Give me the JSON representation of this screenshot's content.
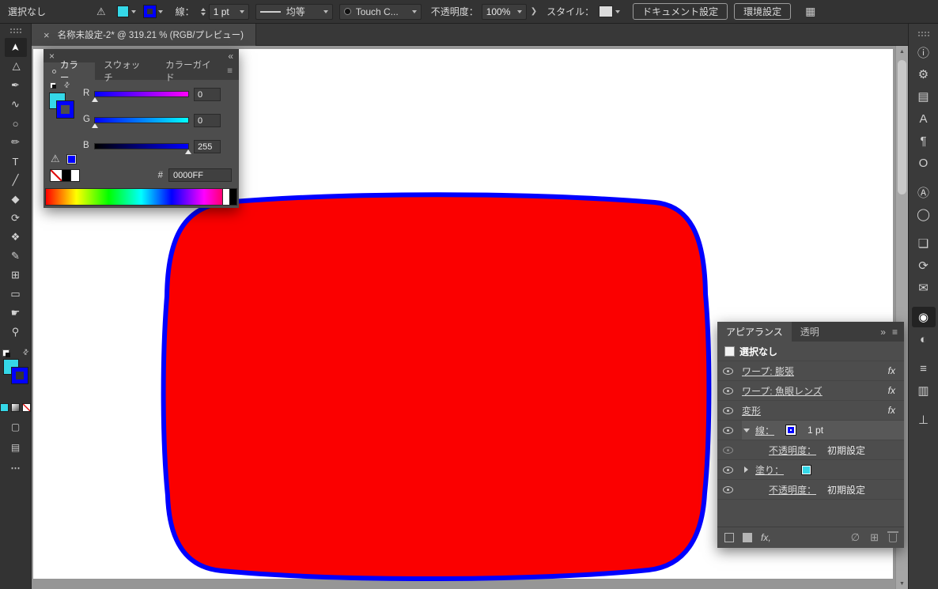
{
  "colors": {
    "fill_cyan": "#35d8e8",
    "stroke_blue": "#0000ff",
    "shape_fill_red": "#fb0000",
    "artboard_white": "#ffffff",
    "pasteboard_gray": "#969696"
  },
  "control_bar": {
    "selection_status": "選択なし",
    "warning_glyph": "⚠",
    "stroke_label": "線：",
    "stroke_weight": "1 pt",
    "stroke_profile": "均等",
    "brush_name": "Touch C...",
    "opacity_label": "不透明度：",
    "opacity_value": "100%",
    "more_chevron": "❯",
    "style_label": "スタイル：",
    "document_setup_button": "ドキュメント設定",
    "preferences_button": "環境設定",
    "workspace_glyph": "▦"
  },
  "document_tab": {
    "close_label": "×",
    "title": "名称未設定-2* @ 319.21 % (RGB/プレビュー)"
  },
  "toolbar": {
    "tools": [
      {
        "name": "selection-tool",
        "glyph": "➤"
      },
      {
        "name": "direct-selection-tool",
        "glyph": "▷"
      },
      {
        "name": "pen-tool",
        "glyph": "✒"
      },
      {
        "name": "curvature-tool",
        "glyph": "∿"
      },
      {
        "name": "ellipse-tool",
        "glyph": "○"
      },
      {
        "name": "paintbrush-tool",
        "glyph": "✏"
      },
      {
        "name": "type-tool",
        "glyph": "T"
      },
      {
        "name": "line-segment-tool",
        "glyph": "╱"
      },
      {
        "name": "shaper-tool",
        "glyph": "◆"
      },
      {
        "name": "rotate-tool",
        "glyph": "⟳"
      },
      {
        "name": "shape-builder-tool",
        "glyph": "❖"
      },
      {
        "name": "pencil-tool",
        "glyph": "✎"
      },
      {
        "name": "mesh-tool",
        "glyph": "⊞"
      },
      {
        "name": "artboard-tool",
        "glyph": "▭"
      },
      {
        "name": "hand-tool",
        "glyph": "☛"
      },
      {
        "name": "zoom-tool",
        "glyph": "⚲"
      }
    ]
  },
  "color_panel": {
    "close_label": "×",
    "collapse_label": "«",
    "menu_label": "≡",
    "tabs": [
      {
        "label": "カラー",
        "active": true
      },
      {
        "label": "スウォッチ"
      },
      {
        "label": "カラーガイド"
      }
    ],
    "warning_glyph": "⚠",
    "sliders": [
      {
        "label": "R",
        "value": "0",
        "track": [
          "#0000ff",
          "#ff00ff"
        ]
      },
      {
        "label": "G",
        "value": "0",
        "track": [
          "#0000ff",
          "#00ffff"
        ]
      },
      {
        "label": "B",
        "value": "255",
        "track": [
          "#000000",
          "#0000ff"
        ]
      }
    ],
    "hex_label": "#",
    "hex_value": "0000FF"
  },
  "appearance_panel": {
    "tabs": [
      {
        "label": "アピアランス",
        "active": true
      },
      {
        "label": "透明"
      }
    ],
    "collapse_label": "»",
    "menu_label": "≡",
    "rows": [
      {
        "label": "選択なし"
      },
      {
        "label": "ワープ: 膨張",
        "fx": "fx"
      },
      {
        "label": "ワープ: 魚眼レンズ",
        "fx": "fx"
      },
      {
        "label": "変形",
        "fx": "fx"
      },
      {
        "label": "線：",
        "value": "1 pt",
        "swatch": "#0000ff"
      },
      {
        "label": "不透明度：",
        "value": "初期設定"
      },
      {
        "label": "塗り：",
        "swatch": "#35d8e8"
      },
      {
        "label": "不透明度：",
        "value": "初期設定"
      }
    ],
    "footer": {
      "fx_label": "fx,",
      "clear_glyph": "∅",
      "duplicate_glyph": "⊞"
    }
  },
  "dock": {
    "icons": [
      {
        "name": "info",
        "glyph": "ⓘ"
      },
      {
        "name": "gear",
        "glyph": "⚙"
      },
      {
        "name": "export",
        "glyph": "▤"
      },
      {
        "name": "character",
        "glyph": "A"
      },
      {
        "name": "paragraph",
        "glyph": "¶"
      },
      {
        "name": "opentype",
        "glyph": "O"
      },
      {
        "name": "character-styles",
        "glyph": "Ⓐ"
      },
      {
        "name": "color",
        "glyph": "◯"
      },
      {
        "name": "libraries",
        "glyph": "❏"
      },
      {
        "name": "sync",
        "glyph": "⟳"
      },
      {
        "name": "comments",
        "glyph": "✉"
      },
      {
        "name": "appearance",
        "glyph": "◉",
        "active": true
      },
      {
        "name": "graphic-styles",
        "glyph": "◐"
      },
      {
        "name": "stroke",
        "glyph": "≡"
      },
      {
        "name": "gradient",
        "glyph": "▥"
      },
      {
        "name": "align",
        "glyph": "⊥"
      }
    ]
  },
  "scrollbar": {
    "up": "▲",
    "down": "▼"
  }
}
